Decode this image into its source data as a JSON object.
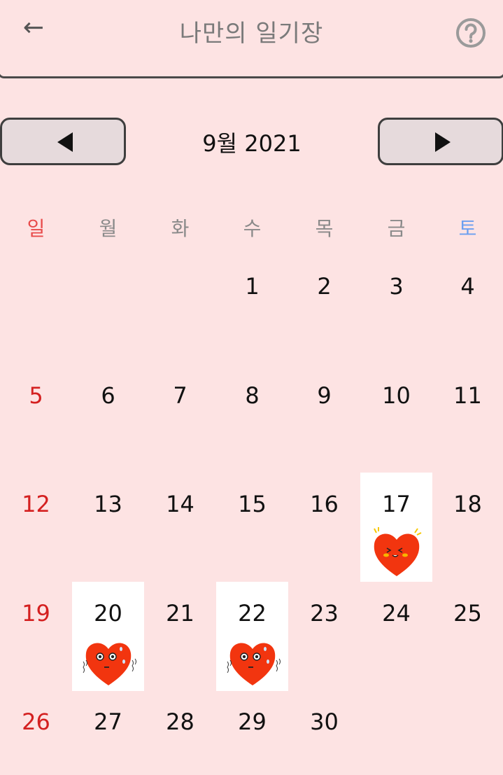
{
  "header": {
    "back_icon": "←",
    "title": "나만의 일기장",
    "help_icon": "question-circle-icon"
  },
  "nav": {
    "month_label": "9월 2021",
    "prev_icon": "triangle-left-icon",
    "next_icon": "triangle-right-icon"
  },
  "weekdays": [
    "일",
    "월",
    "화",
    "수",
    "목",
    "금",
    "토"
  ],
  "colors": {
    "background": "#fde3e3",
    "sunday": "#d42020",
    "saturday": "#6b9ff0",
    "heart": "#f2350f"
  },
  "calendar": {
    "first_weekday_index": 3,
    "days_in_month": 30,
    "diary_entries": [
      {
        "day": 17,
        "sticker": "happy-heart-icon"
      },
      {
        "day": 20,
        "sticker": "worried-heart-icon"
      },
      {
        "day": 22,
        "sticker": "worried-heart-icon"
      }
    ]
  }
}
